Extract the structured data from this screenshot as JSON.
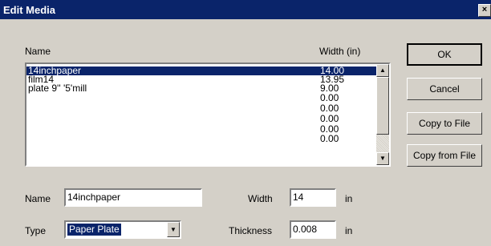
{
  "window": {
    "title": "Edit Media",
    "close_glyph": "×"
  },
  "list": {
    "headers": {
      "name": "Name",
      "width": "Width (in)"
    },
    "rows": [
      {
        "name": "14inchpaper",
        "width": "14.00",
        "selected": true
      },
      {
        "name": "film14",
        "width": "13.95"
      },
      {
        "name": "plate 9'' '5'mill",
        "width": "9.00"
      },
      {
        "name": "",
        "width": "0.00"
      },
      {
        "name": "",
        "width": "0.00"
      },
      {
        "name": "",
        "width": "0.00"
      },
      {
        "name": "",
        "width": "0.00"
      },
      {
        "name": "",
        "width": "0.00"
      }
    ]
  },
  "buttons": {
    "ok": "OK",
    "cancel": "Cancel",
    "copy_to_file": "Copy to File",
    "copy_from_file": "Copy from File"
  },
  "form": {
    "name_label": "Name",
    "name_value": "14inchpaper",
    "type_label": "Type",
    "type_value": "Paper Plate",
    "width_label": "Width",
    "width_value": "14",
    "width_unit": "in",
    "thickness_label": "Thickness",
    "thickness_value": "0.008",
    "thickness_unit": "in"
  },
  "icons": {
    "scroll_up": "▲",
    "scroll_down": "▼",
    "dropdown": "▼"
  },
  "colors": {
    "titlebar": "#0a246a",
    "selection": "#0a246a",
    "face": "#d4d0c8"
  }
}
